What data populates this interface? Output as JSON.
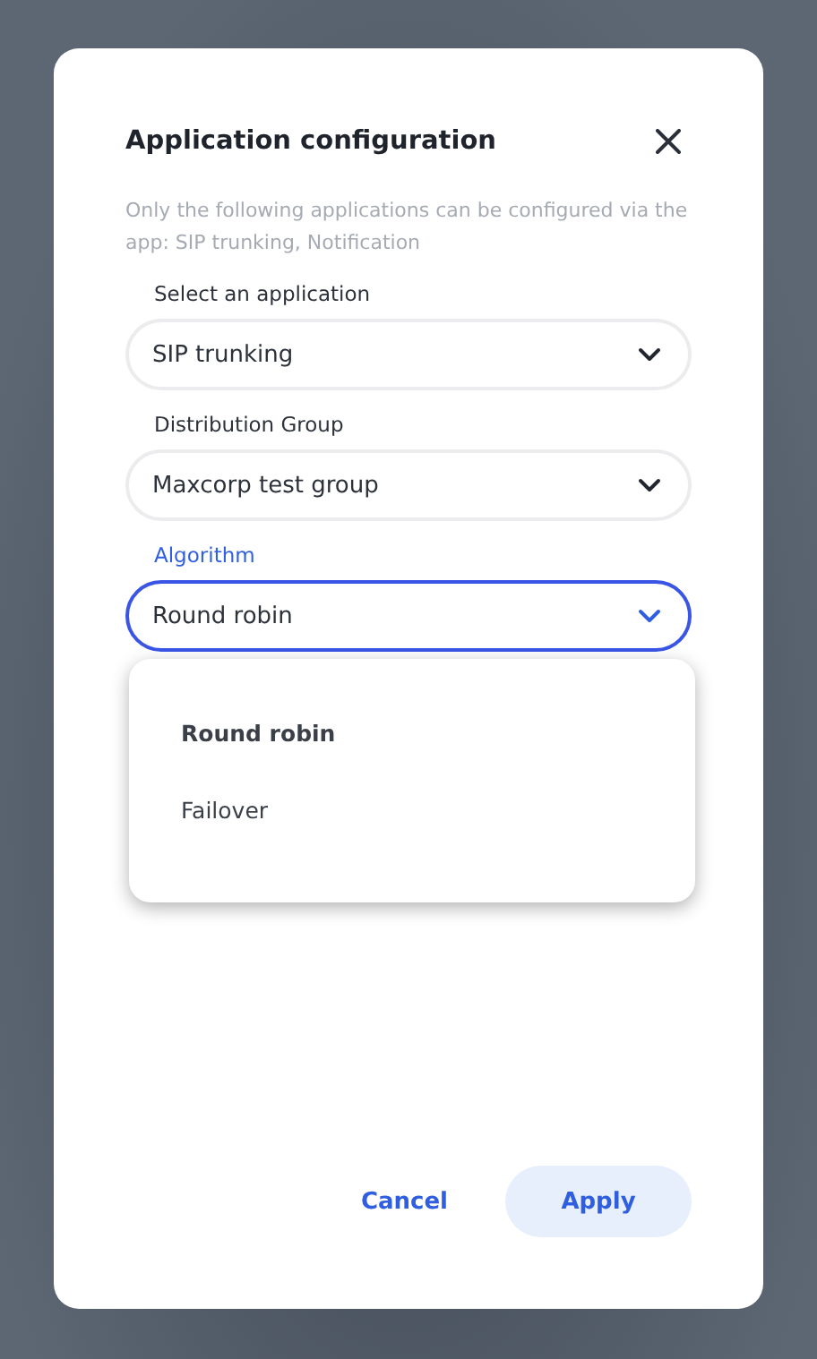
{
  "dialog": {
    "title": "Application configuration",
    "description": "Only the following applications can be configured via the app: SIP trunking, Notification",
    "fields": [
      {
        "label": "Select an application",
        "value": "SIP trunking",
        "focused": false
      },
      {
        "label": "Distribution Group",
        "value": "Maxcorp test group",
        "focused": false
      },
      {
        "label": "Algorithm",
        "value": "Round robin",
        "focused": true
      }
    ],
    "dropdown": {
      "options": [
        {
          "label": "Round robin",
          "selected": true
        },
        {
          "label": "Failover",
          "selected": false
        }
      ]
    },
    "buttons": {
      "cancel": "Cancel",
      "apply": "Apply"
    }
  }
}
